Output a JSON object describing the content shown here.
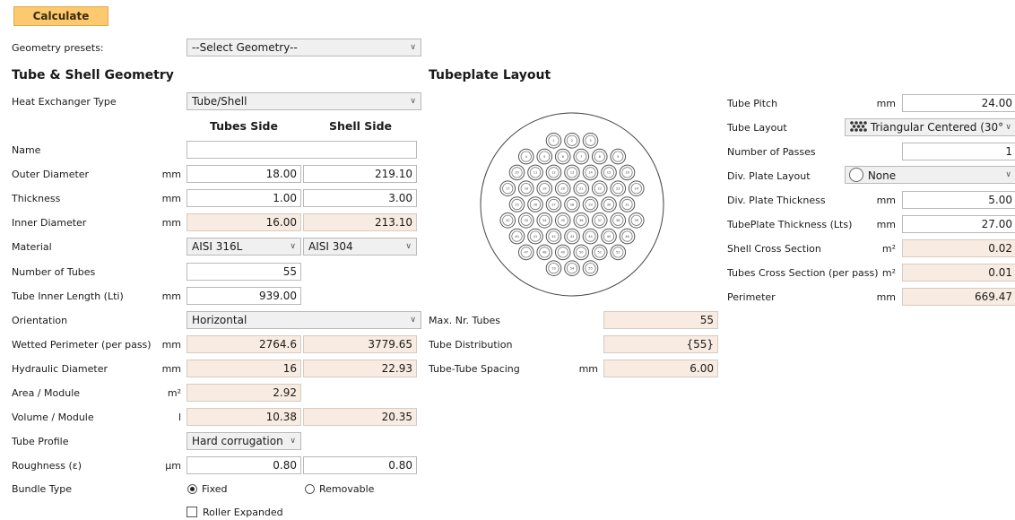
{
  "calculate_label": "Calculate",
  "presets": {
    "label": "Geometry presets:",
    "value": "--Select Geometry--"
  },
  "tube_shell": {
    "header": "Tube & Shell Geometry",
    "col_tubes": "Tubes Side",
    "col_shell": "Shell Side",
    "hx_type": {
      "label": "Heat Exchanger Type",
      "value": "Tube/Shell"
    },
    "name": {
      "label": "Name",
      "value": ""
    },
    "outer_diameter": {
      "label": "Outer Diameter",
      "unit": "mm",
      "tubes": "18.00",
      "shell": "219.10"
    },
    "thickness": {
      "label": "Thickness",
      "unit": "mm",
      "tubes": "1.00",
      "shell": "3.00"
    },
    "inner_diameter": {
      "label": "Inner Diameter",
      "unit": "mm",
      "tubes": "16.00",
      "shell": "213.10"
    },
    "material": {
      "label": "Material",
      "tubes": "AISI 316L",
      "shell": "AISI 304"
    },
    "number_of_tubes": {
      "label": "Number of Tubes",
      "value": "55"
    },
    "tube_inner_length": {
      "label": "Tube Inner Length (Lti)",
      "unit": "mm",
      "value": "939.00"
    },
    "orientation": {
      "label": "Orientation",
      "value": "Horizontal"
    },
    "wetted_perimeter": {
      "label": "Wetted Perimeter (per pass)",
      "unit": "mm",
      "tubes": "2764.6",
      "shell": "3779.65"
    },
    "hydraulic_diameter": {
      "label": "Hydraulic Diameter",
      "unit": "mm",
      "tubes": "16",
      "shell": "22.93"
    },
    "area_module": {
      "label": "Area / Module",
      "unit": "m²",
      "value": "2.92"
    },
    "volume_module": {
      "label": "Volume / Module",
      "unit": "l",
      "tubes": "10.38",
      "shell": "20.35"
    },
    "tube_profile": {
      "label": "Tube Profile",
      "value": "Hard corrugation"
    },
    "roughness": {
      "label": "Roughness (ε)",
      "unit": "µm",
      "tubes": "0.80",
      "shell": "0.80"
    },
    "bundle_type": {
      "label": "Bundle Type",
      "option_fixed": "Fixed",
      "option_removable": "Removable",
      "selected": "Fixed"
    },
    "roller_expanded": {
      "label": "Roller Expanded",
      "checked": false
    }
  },
  "tubeplate": {
    "header": "Tubeplate Layout",
    "max_nr_tubes": {
      "label": "Max. Nr. Tubes",
      "value": "55"
    },
    "tube_distribution": {
      "label": "Tube Distribution",
      "value": "{55}"
    },
    "tube_spacing": {
      "label": "Tube-Tube Spacing",
      "unit": "mm",
      "value": "6.00"
    },
    "tube_numbers": [
      "1",
      "2",
      "3",
      "4",
      "5",
      "6",
      "7",
      "8",
      "9",
      "10",
      "11",
      "12",
      "13",
      "14",
      "15",
      "16",
      "17",
      "18",
      "19",
      "20",
      "21",
      "22",
      "23",
      "24",
      "25",
      "26",
      "27",
      "28",
      "29",
      "30",
      "31",
      "32",
      "33",
      "34",
      "35",
      "36",
      "37",
      "38",
      "39",
      "40",
      "41",
      "42",
      "43",
      "44",
      "45",
      "46",
      "47",
      "48",
      "49",
      "50",
      "51",
      "52",
      "53",
      "54",
      "55"
    ]
  },
  "right_panel": {
    "tube_pitch": {
      "label": "Tube Pitch",
      "unit": "mm",
      "value": "24.00"
    },
    "tube_layout": {
      "label": "Tube Layout",
      "value": "Triangular Centered (30°)",
      "icon": "triangular-layout-icon"
    },
    "number_of_passes": {
      "label": "Number of Passes",
      "value": "1"
    },
    "div_plate_layout": {
      "label": "Div. Plate Layout",
      "value": "None",
      "icon": "circle-icon"
    },
    "div_plate_thickness": {
      "label": "Div. Plate Thickness",
      "unit": "mm",
      "value": "5.00"
    },
    "tubeplate_thickness": {
      "label": "TubePlate Thickness (Lts)",
      "unit": "mm",
      "value": "27.00"
    },
    "shell_cross_section": {
      "label": "Shell Cross Section",
      "unit": "m²",
      "value": "0.02"
    },
    "tubes_cross_section": {
      "label": "Tubes Cross Section (per pass)",
      "unit": "m²",
      "value": "0.01"
    },
    "perimeter": {
      "label": "Perimeter",
      "unit": "mm",
      "value": "669.47"
    }
  },
  "colors": {
    "readonly_bg": "#f8ebe1",
    "button_bg": "#fcc96f",
    "border": "#b9b9b9"
  }
}
